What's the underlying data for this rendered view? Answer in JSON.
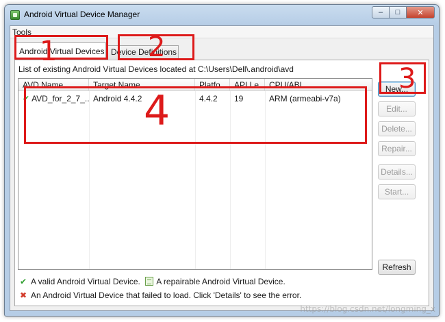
{
  "window": {
    "title": "Android Virtual Device Manager",
    "buttons": {
      "minimize": "–",
      "maximize": "□",
      "close": "✕"
    }
  },
  "menu": {
    "tools": "Tools"
  },
  "tabs": [
    {
      "label": "Android Virtual Devices",
      "active": true
    },
    {
      "label": "Device Definitions",
      "active": false
    }
  ],
  "path_label": "List of existing Android Virtual Devices located at C:\\Users\\Dell\\.android\\avd",
  "table": {
    "columns": [
      "AVD Name",
      "Target Name",
      "Platfo",
      "API Le",
      "CPU/ABI"
    ],
    "rows": [
      {
        "status_icon": "check-icon",
        "name": "AVD_for_2_7_...",
        "target": "Android 4.4.2",
        "platform": "4.4.2",
        "api": "19",
        "cpu": "ARM (armeabi-v7a)"
      }
    ]
  },
  "actions": {
    "new": "New...",
    "edit": "Edit...",
    "delete": "Delete...",
    "repair": "Repair...",
    "details": "Details...",
    "start": "Start...",
    "refresh": "Refresh"
  },
  "legend": {
    "valid": "A valid Android Virtual Device.",
    "repairable": "A repairable Android Virtual Device.",
    "failed": "An Android Virtual Device that failed to load. Click 'Details' to see the error."
  },
  "annotations": {
    "n1": "1",
    "n2": "2",
    "n3": "3",
    "n4": "4"
  },
  "watermark": "https://blog.csdn.net/longming_x",
  "colors": {
    "annotation": "#dd1a1a",
    "valid": "#2f9e2f",
    "failed": "#d23b2b"
  }
}
